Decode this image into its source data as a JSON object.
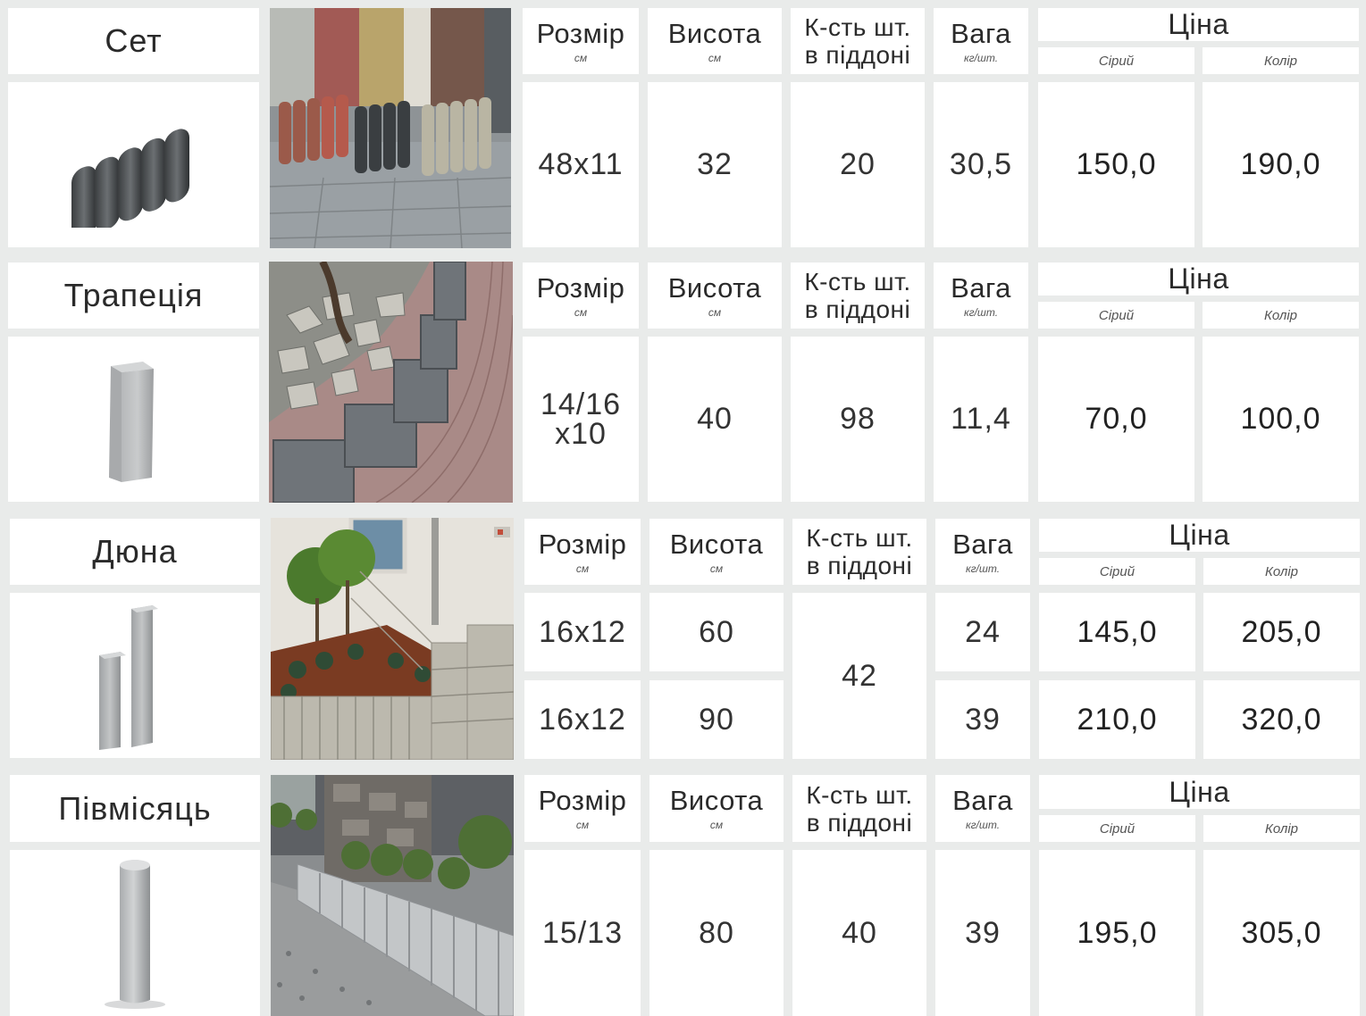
{
  "labels": {
    "size": "Розмір",
    "height": "Висота",
    "qty_line1": "К-сть шт.",
    "qty_line2": "в піддоні",
    "weight": "Вага",
    "unit_cm": "см",
    "unit_kg": "кг/шт.",
    "price": "Ціна",
    "grey": "Сірий",
    "color": "Колір"
  },
  "products": [
    {
      "name": "Сет",
      "size": "48x11",
      "height": "32",
      "qty": "20",
      "weight": "30,5",
      "price_grey": "150,0",
      "price_color": "190,0"
    },
    {
      "name": "Трапеція",
      "size_line1": "14/16",
      "size_line2": "x10",
      "height": "40",
      "qty": "98",
      "weight": "11,4",
      "price_grey": "70,0",
      "price_color": "100,0"
    },
    {
      "name": "Дюна",
      "rows": [
        {
          "size": "16x12",
          "height": "60",
          "weight": "24",
          "price_grey": "145,0",
          "price_color": "205,0"
        },
        {
          "size": "16x12",
          "height": "90",
          "weight": "39",
          "price_grey": "210,0",
          "price_color": "320,0"
        }
      ],
      "qty": "42"
    },
    {
      "name": "Півмісяць",
      "size": "15/13",
      "height": "80",
      "qty": "40",
      "weight": "39",
      "price_grey": "195,0",
      "price_color": "305,0"
    }
  ],
  "icons": [
    "palisade-set-icon",
    "trapezoid-block-icon",
    "dune-posts-icon",
    "half-moon-post-icon"
  ],
  "colors": {
    "background": "#e9ebea",
    "cell": "#ffffff",
    "text": "#2b2b2b"
  }
}
